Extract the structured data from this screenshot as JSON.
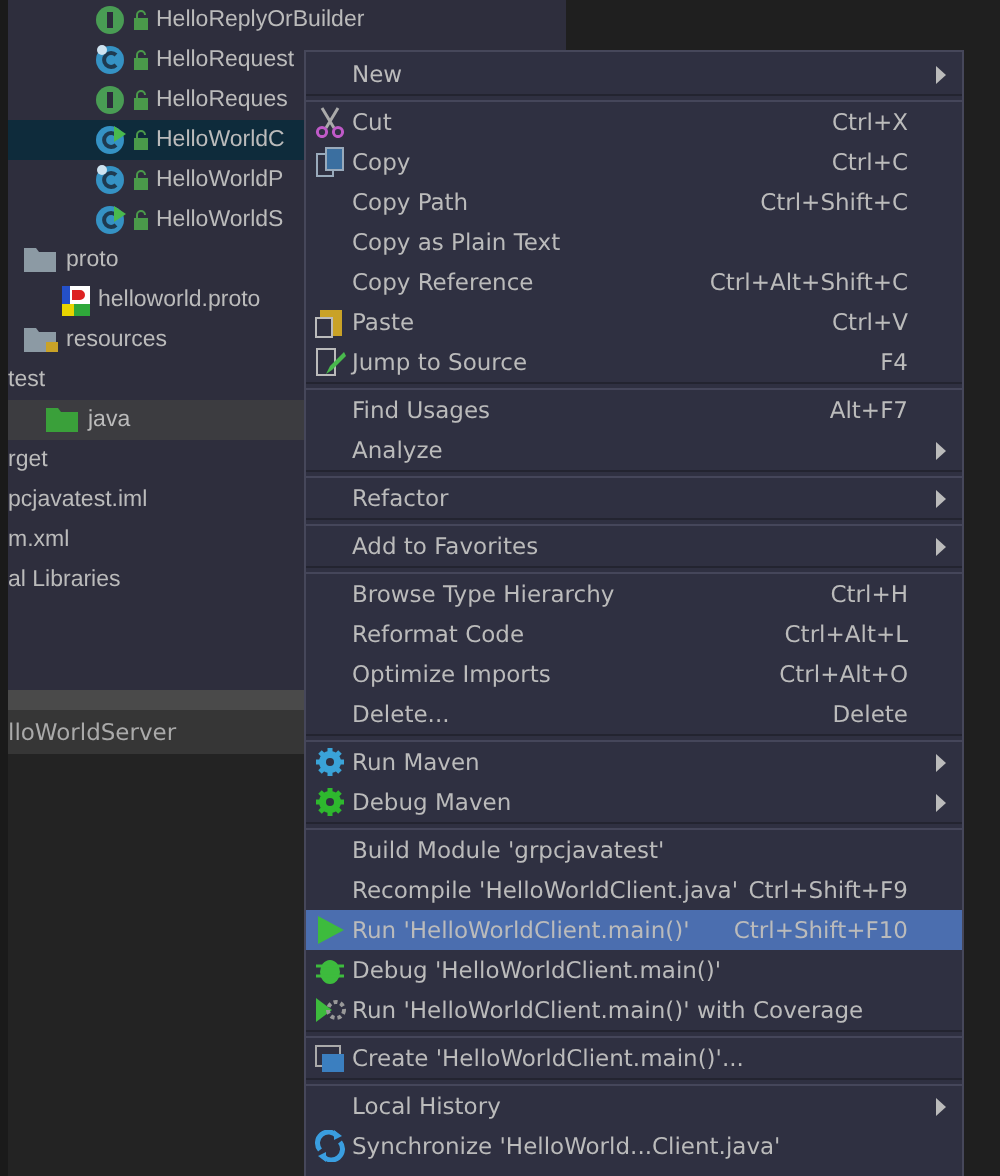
{
  "project_tree": {
    "package_items": [
      {
        "label": "HelloReplyOrBuilder",
        "kind": "interface",
        "selected": false
      },
      {
        "label": "HelloRequest",
        "kind": "class",
        "selected": false
      },
      {
        "label": "HelloReques",
        "kind": "interface",
        "selected": false
      },
      {
        "label": "HelloWorldC",
        "kind": "runnable-class",
        "selected": true
      },
      {
        "label": "HelloWorldP",
        "kind": "class",
        "selected": false
      },
      {
        "label": "HelloWorldS",
        "kind": "runnable-class",
        "selected": false
      }
    ],
    "source_folders": [
      {
        "label": "proto",
        "kind": "folder",
        "selected": false,
        "children": [
          {
            "label": "helloworld.proto",
            "kind": "proto-file",
            "selected": false
          }
        ]
      },
      {
        "label": "resources",
        "kind": "resources-folder",
        "selected": false
      }
    ],
    "modules": [
      {
        "label": "test",
        "selected": false,
        "children": [
          {
            "label": "java",
            "kind": "test-folder",
            "selected": true
          }
        ]
      },
      {
        "label": "rget",
        "selected": false
      },
      {
        "label": "pcjavatest.iml",
        "selected": false
      },
      {
        "label": "m.xml",
        "selected": false
      },
      {
        "label": "al Libraries",
        "selected": false
      }
    ]
  },
  "bottom_tab": {
    "label": "lloWorldServer"
  },
  "context_menu": {
    "groups": [
      [
        {
          "label": "New",
          "submenu": true,
          "kind": "plain",
          "selected": false
        }
      ],
      [
        {
          "label": "Cut",
          "shortcut": "Ctrl+X",
          "submenu": false,
          "kind": "scissors",
          "selected": false
        },
        {
          "label": "Copy",
          "shortcut": "Ctrl+C",
          "submenu": false,
          "kind": "copy",
          "selected": false
        },
        {
          "label": "Copy Path",
          "shortcut": "Ctrl+Shift+C",
          "submenu": false,
          "kind": "plain",
          "selected": false
        },
        {
          "label": "Copy as Plain Text",
          "submenu": false,
          "kind": "plain",
          "selected": false
        },
        {
          "label": "Copy Reference",
          "shortcut": "Ctrl+Alt+Shift+C",
          "submenu": false,
          "kind": "plain",
          "selected": false
        },
        {
          "label": "Paste",
          "shortcut": "Ctrl+V",
          "submenu": false,
          "kind": "paste",
          "selected": false
        },
        {
          "label": "Jump to Source",
          "shortcut": "F4",
          "submenu": false,
          "kind": "edit",
          "selected": false
        }
      ],
      [
        {
          "label": "Find Usages",
          "shortcut": "Alt+F7",
          "submenu": false,
          "kind": "plain",
          "selected": false
        },
        {
          "label": "Analyze",
          "submenu": true,
          "kind": "plain",
          "selected": false
        }
      ],
      [
        {
          "label": "Refactor",
          "submenu": true,
          "kind": "plain",
          "selected": false
        }
      ],
      [
        {
          "label": "Add to Favorites",
          "submenu": true,
          "kind": "plain",
          "selected": false
        }
      ],
      [
        {
          "label": "Browse Type Hierarchy",
          "shortcut": "Ctrl+H",
          "submenu": false,
          "kind": "plain",
          "selected": false
        },
        {
          "label": "Reformat Code",
          "shortcut": "Ctrl+Alt+L",
          "submenu": false,
          "kind": "plain",
          "selected": false
        },
        {
          "label": "Optimize Imports",
          "shortcut": "Ctrl+Alt+O",
          "submenu": false,
          "kind": "plain",
          "selected": false
        },
        {
          "label": "Delete...",
          "shortcut": "Delete",
          "submenu": false,
          "kind": "plain",
          "selected": false
        }
      ],
      [
        {
          "label": "Run Maven",
          "submenu": true,
          "kind": "gear-run",
          "selected": false
        },
        {
          "label": "Debug Maven",
          "submenu": true,
          "kind": "gear-debug",
          "selected": false
        }
      ],
      [
        {
          "label": "Build Module 'grpcjavatest'",
          "submenu": false,
          "kind": "plain",
          "selected": false
        },
        {
          "label": "Recompile 'HelloWorldClient.java'",
          "shortcut": "Ctrl+Shift+F9",
          "submenu": false,
          "kind": "plain",
          "selected": false
        },
        {
          "label": "Run 'HelloWorldClient.main()'",
          "shortcut": "Ctrl+Shift+F10",
          "submenu": false,
          "kind": "run",
          "selected": true
        },
        {
          "label": "Debug 'HelloWorldClient.main()'",
          "submenu": false,
          "kind": "debug",
          "selected": false
        },
        {
          "label": "Run 'HelloWorldClient.main()' with Coverage",
          "submenu": false,
          "kind": "coverage",
          "selected": false
        }
      ],
      [
        {
          "label": "Create 'HelloWorldClient.main()'...",
          "submenu": false,
          "kind": "create",
          "selected": false
        }
      ],
      [
        {
          "label": "Local History",
          "submenu": true,
          "kind": "plain",
          "selected": false
        },
        {
          "label": "Synchronize 'HelloWorld...Client.java'",
          "submenu": false,
          "kind": "sync",
          "selected": false
        }
      ]
    ]
  }
}
